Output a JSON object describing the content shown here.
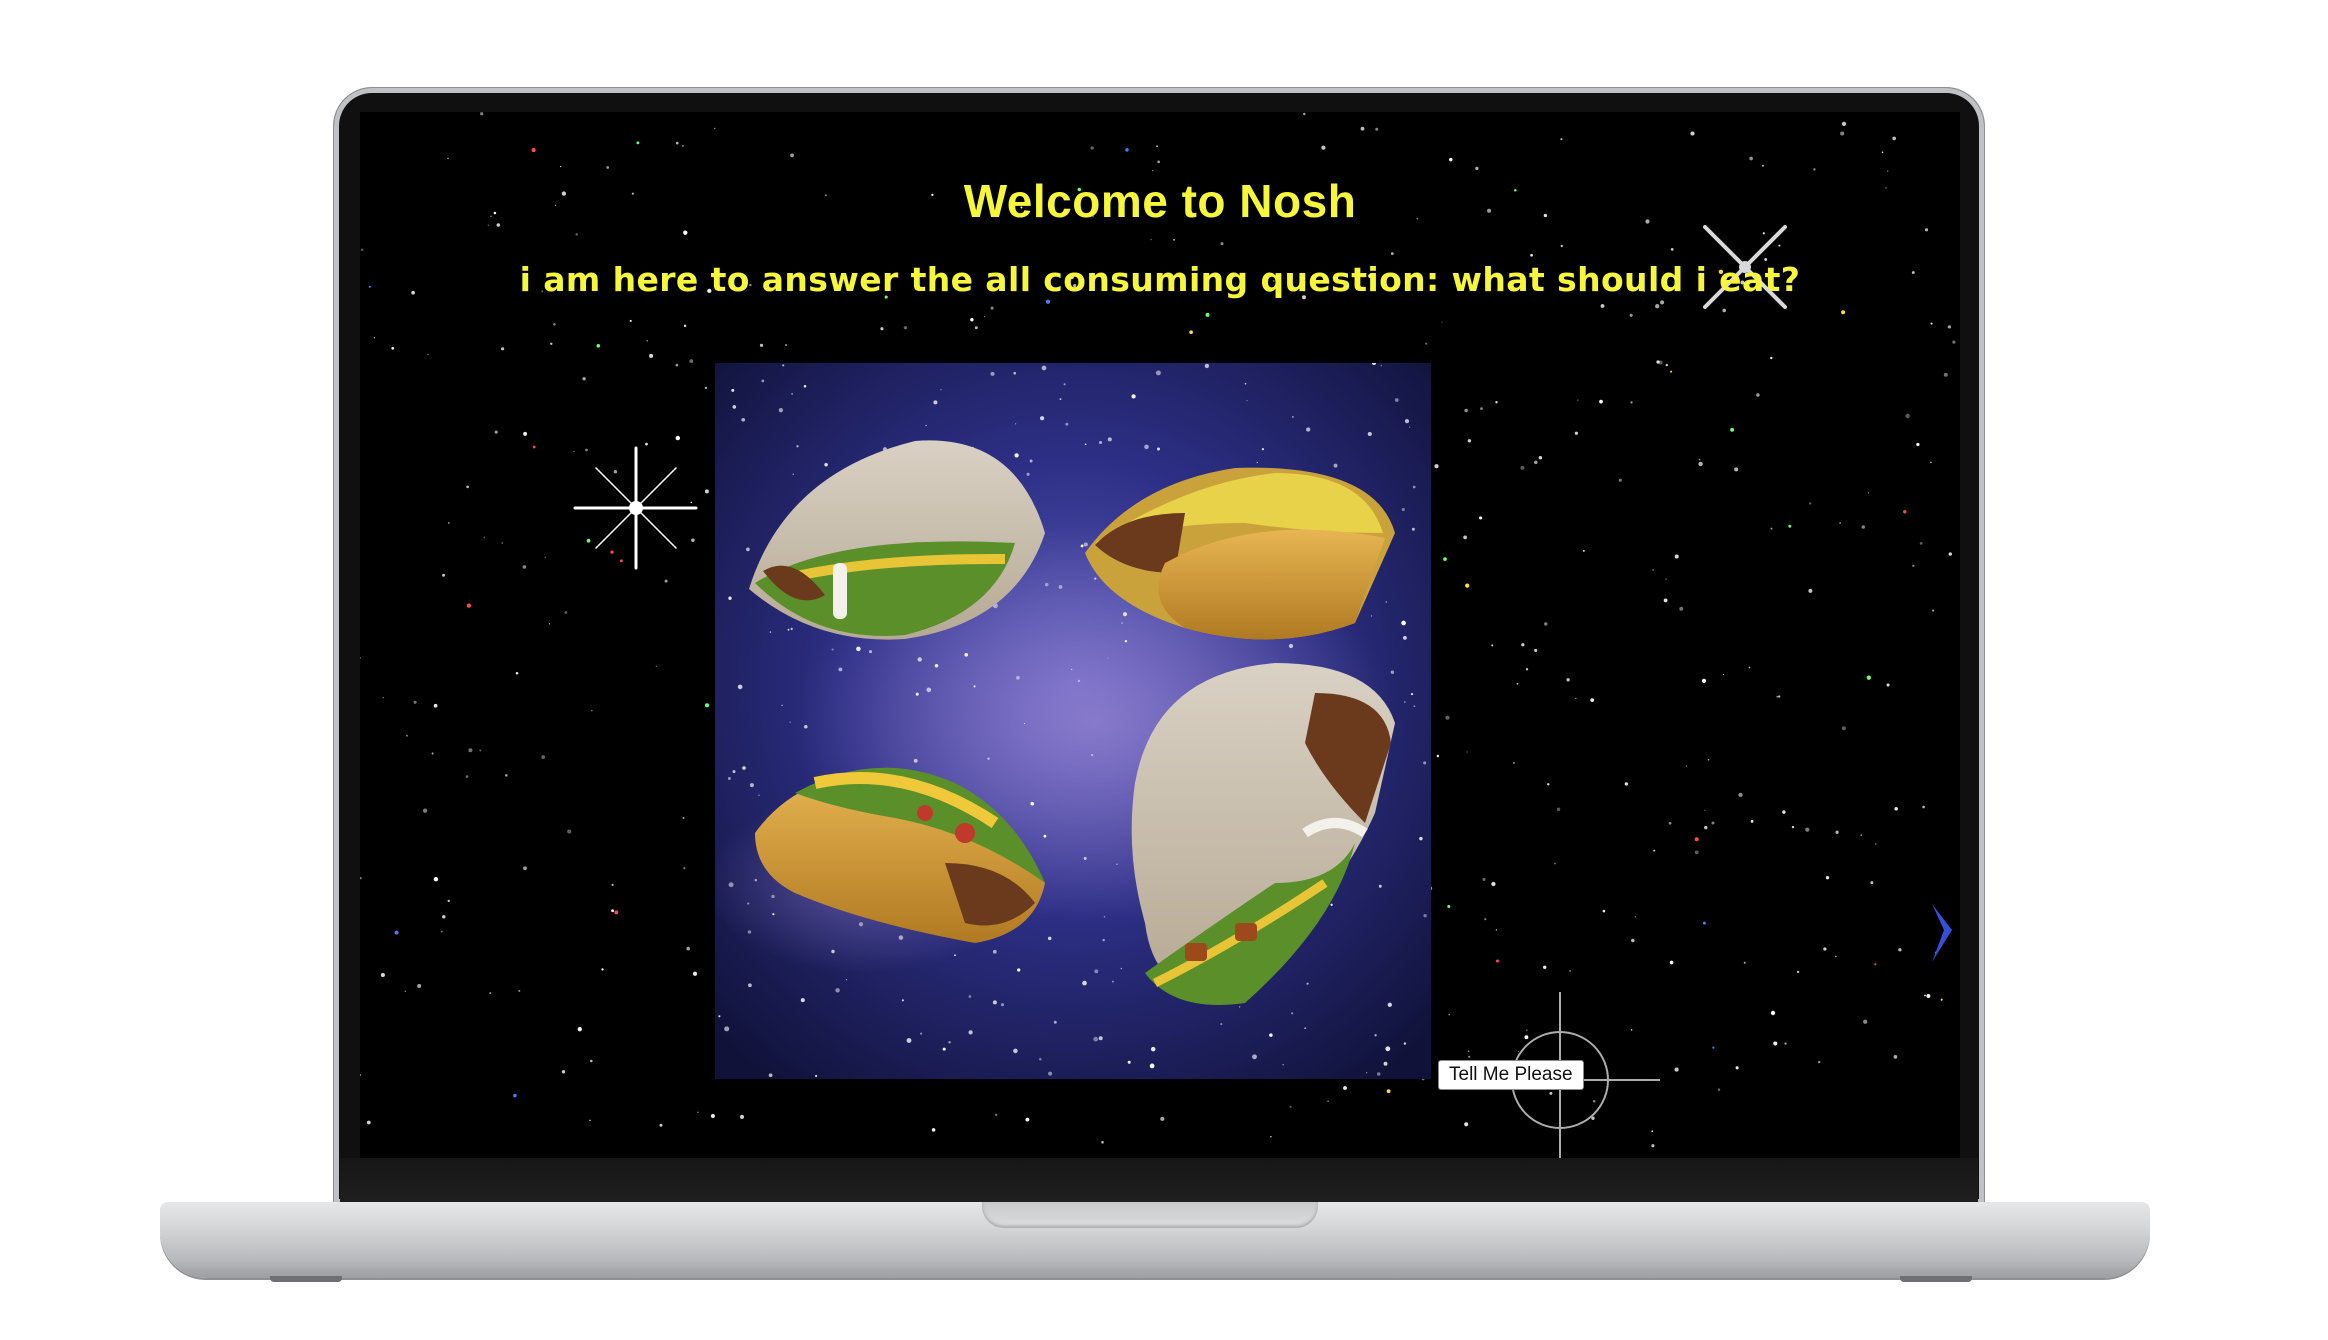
{
  "page": {
    "title": "Welcome to Nosh",
    "subtitle": "i am here to answer the all consuming question: what should i eat?"
  },
  "hero_image": {
    "description_icons": [
      "hard-shell-taco-icon",
      "soft-taco-icon",
      "double-decker-taco-icon",
      "galaxy-background"
    ]
  },
  "actions": {
    "tell_me_label": "Tell Me Please"
  },
  "colors": {
    "background": "#000000",
    "heading": "#f6f63a",
    "button_bg": "#ffffff",
    "galaxy": "#1b1c55"
  }
}
